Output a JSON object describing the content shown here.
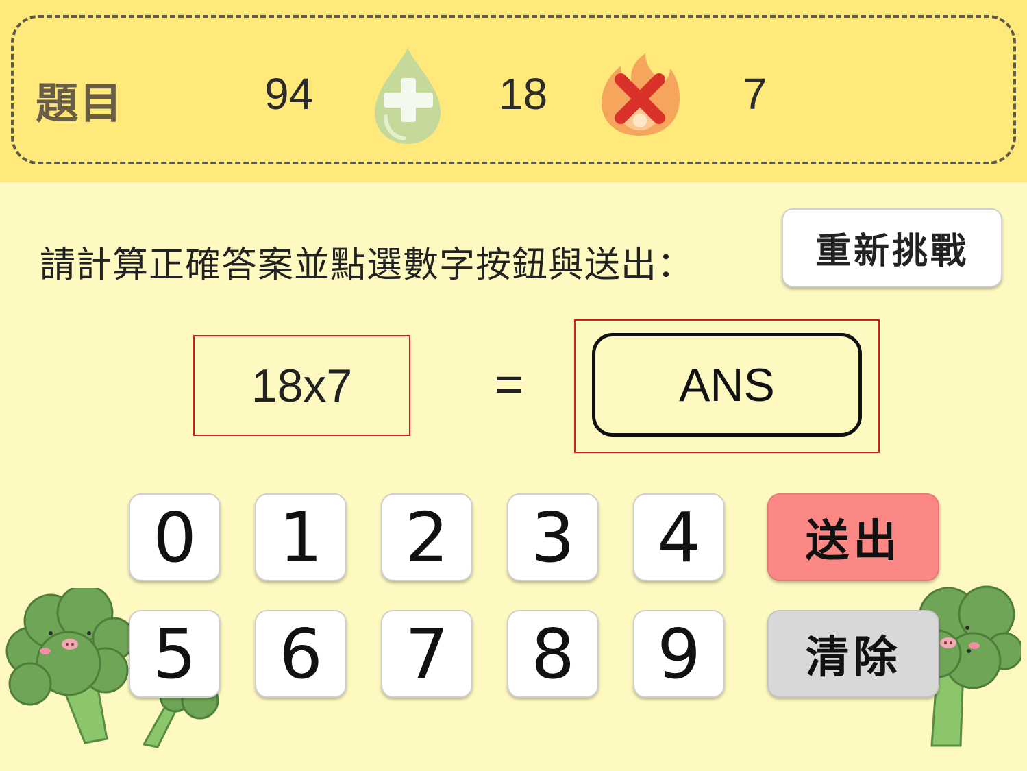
{
  "header": {
    "label": "題目",
    "score": "94",
    "operand_a": "18",
    "operand_b": "7"
  },
  "instruction": "請計算正確答案並點選數字按鈕與送出：",
  "retry_label": "重新挑戰",
  "question": "18x7",
  "equals": "=",
  "answer": "ANS",
  "keypad": {
    "row1": [
      "0",
      "1",
      "2",
      "3",
      "4"
    ],
    "row2": [
      "5",
      "6",
      "7",
      "8",
      "9"
    ],
    "submit_label": "送出",
    "clear_label": "清除"
  },
  "colors": {
    "header_bg": "#ffe97a",
    "page_bg": "#fef9c0",
    "submit_bg": "#fb8885",
    "clear_bg": "#d8d8d8",
    "highlight_border": "#d8191f"
  },
  "icons": {
    "plus": "green-drop-plus-icon",
    "times": "fire-cross-icon"
  }
}
